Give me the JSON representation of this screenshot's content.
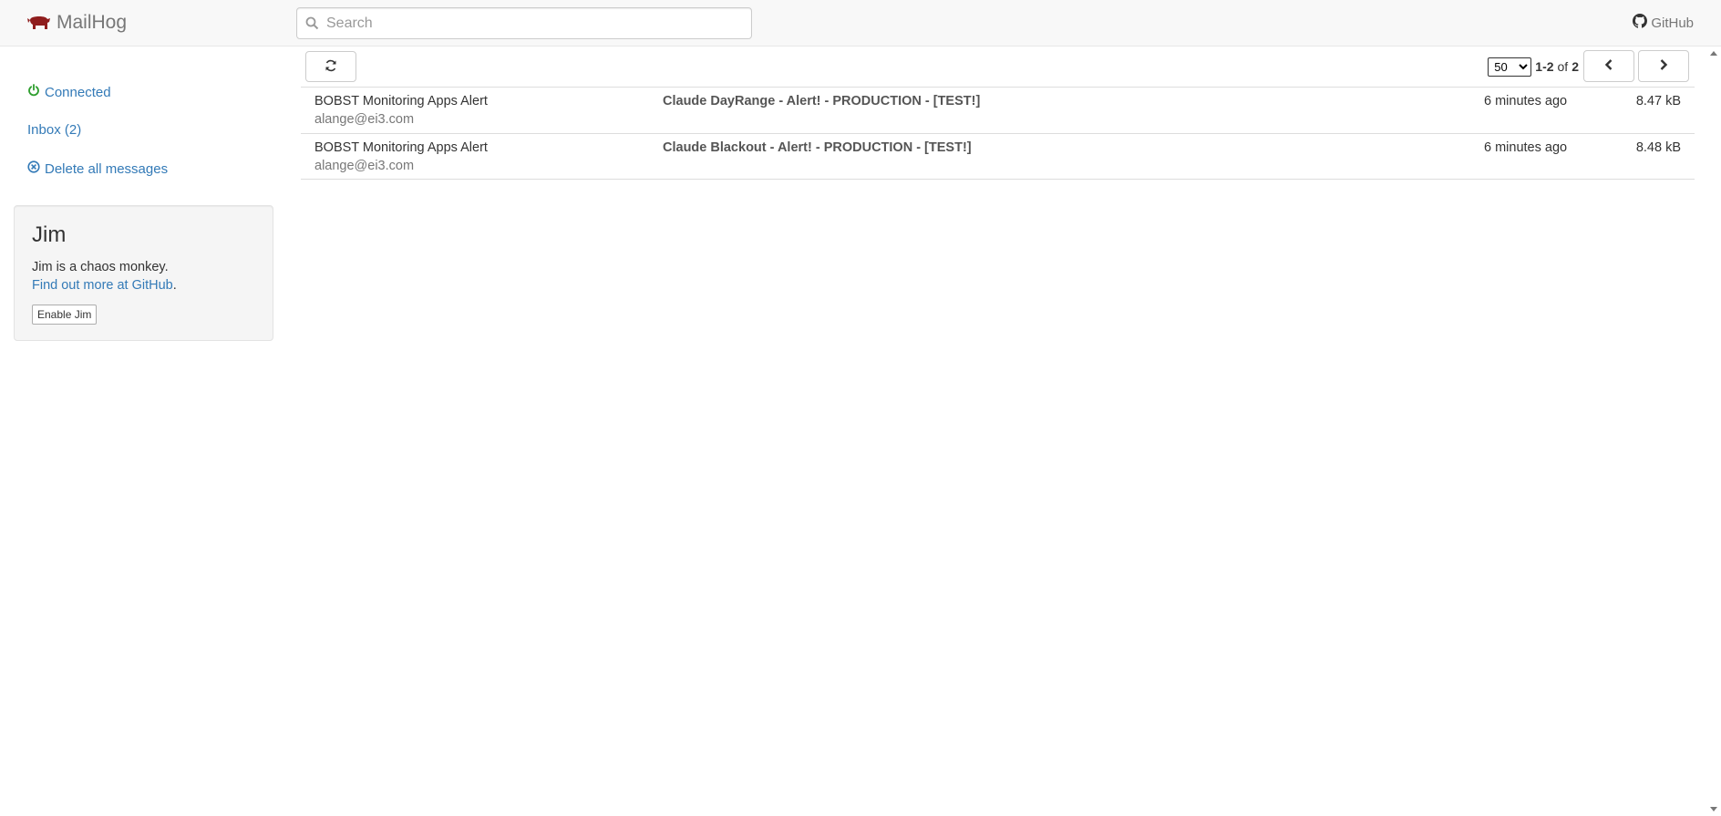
{
  "navbar": {
    "brand": "MailHog",
    "logo_icon": "pig-icon",
    "brand_color": "#8f1d1d",
    "search_placeholder": "Search",
    "github_label": "GitHub"
  },
  "sidebar": {
    "connected_label": "Connected",
    "connected_color": "#2e9e2e",
    "inbox_label": "Inbox (2)",
    "delete_label": "Delete all messages"
  },
  "jim": {
    "title": "Jim",
    "description": "Jim is a chaos monkey.",
    "link_label": "Find out more at GitHub",
    "link_suffix": ".",
    "button_label": "Enable Jim"
  },
  "toolbar": {
    "refresh_icon": "refresh-icon",
    "page_size": "50",
    "page_size_options": [
      "10",
      "20",
      "50",
      "100",
      "250"
    ],
    "range": "1-2",
    "of_label": "of",
    "total": "2"
  },
  "messages": [
    {
      "from_name": "BOBST Monitoring Apps Alert",
      "from_email": "alange@ei3.com",
      "subject": "Claude DayRange - Alert! - PRODUCTION - [TEST!]",
      "time": "6 minutes ago",
      "size": "8.47 kB"
    },
    {
      "from_name": "BOBST Monitoring Apps Alert",
      "from_email": "alange@ei3.com",
      "subject": "Claude Blackout - Alert! - PRODUCTION - [TEST!]",
      "time": "6 minutes ago",
      "size": "8.48 kB"
    }
  ]
}
